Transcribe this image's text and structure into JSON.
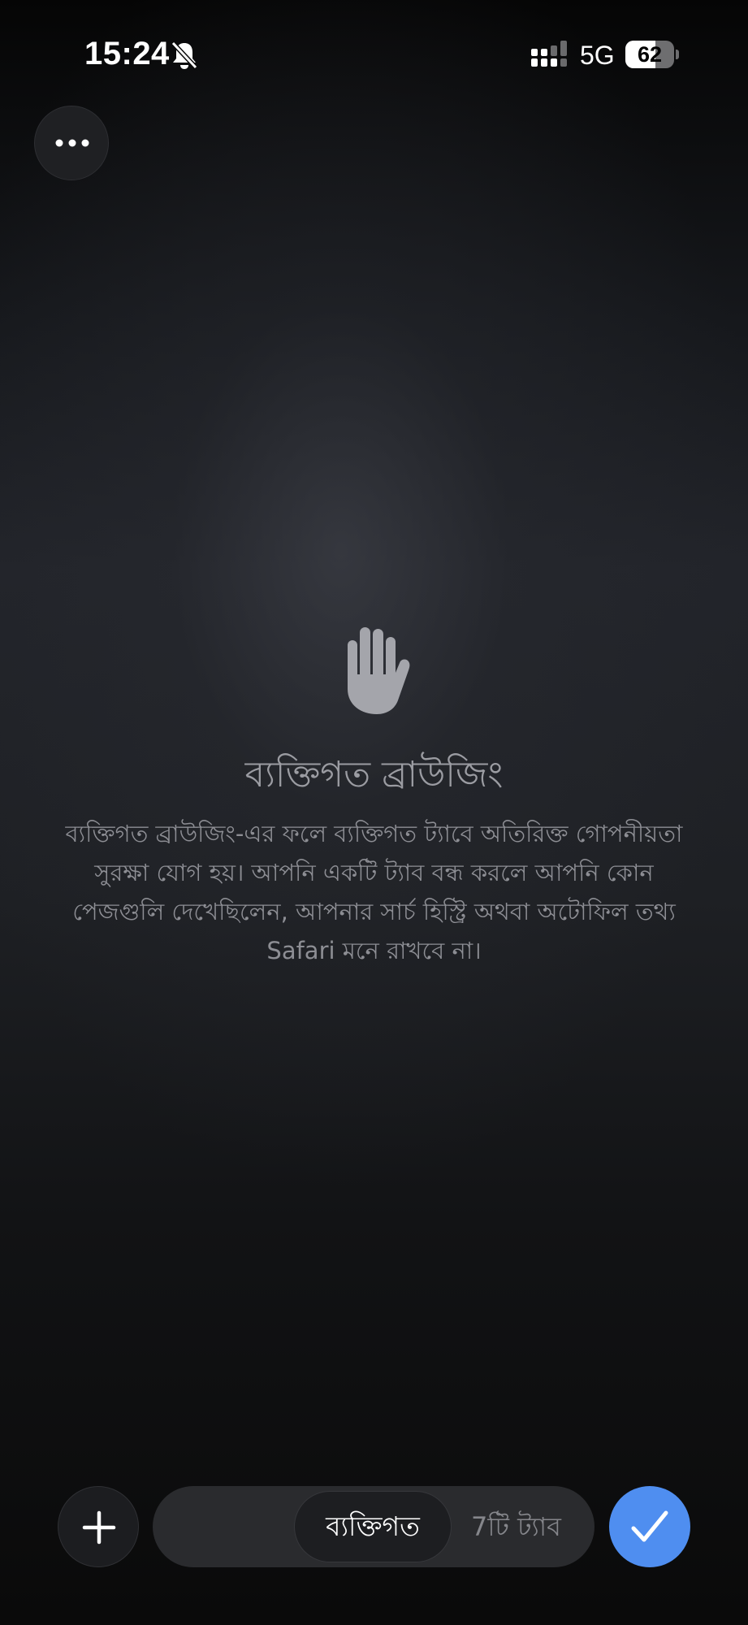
{
  "status_bar": {
    "time": "15:24",
    "network": "5G",
    "battery_level": "62",
    "battery_fraction": 0.62,
    "icons": [
      "bell-slash-icon",
      "cellular-signal-icon"
    ]
  },
  "toolbar_top": {
    "more_icon": "ellipsis-icon"
  },
  "private_notice": {
    "icon": "raised-hand-icon",
    "title": "ব্যক্তিগত ব্রাউজিং",
    "description": "ব্যক্তিগত ব্রাউজিং-এর ফলে ব্যক্তিগত ট্যাবে অতিরিক্ত গোপনীয়তা সুরক্ষা যোগ হয়। আপনি একটি ট্যাব বন্ধ করলে আপনি কোন পেজগুলি দেখেছিলেন, আপনার সার্চ হিস্ট্রি অথবা অটোফিল তথ্য Safari মনে রাখবে না।"
  },
  "bottom_toolbar": {
    "add_icon": "plus-icon",
    "segments": [
      {
        "label": "ব্যক্তিগত",
        "selected": true
      },
      {
        "label": "7টি ট্যাব",
        "selected": false
      }
    ],
    "done_icon": "checkmark-icon",
    "accent_color": "#4f8ef0"
  }
}
